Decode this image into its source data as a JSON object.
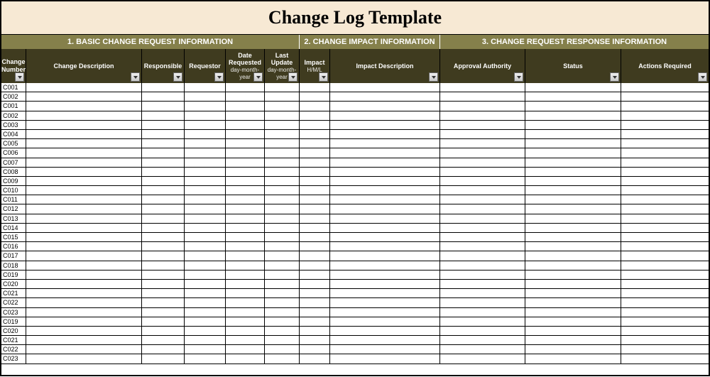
{
  "title": "Change Log Template",
  "sections": [
    "1. BASIC CHANGE REQUEST INFORMATION",
    "2. CHANGE IMPACT INFORMATION",
    "3. CHANGE REQUEST RESPONSE INFORMATION"
  ],
  "columns": [
    {
      "label": "Change Number",
      "sub": ""
    },
    {
      "label": "Change Description",
      "sub": ""
    },
    {
      "label": "Responsible",
      "sub": ""
    },
    {
      "label": "Requestor",
      "sub": ""
    },
    {
      "label": "Date Requested",
      "sub": "day-month-year"
    },
    {
      "label": "Last Update",
      "sub": "day-month-year"
    },
    {
      "label": "Impact",
      "sub": "H/M/L"
    },
    {
      "label": "Impact Description",
      "sub": ""
    },
    {
      "label": "Approval Authority",
      "sub": ""
    },
    {
      "label": "Status",
      "sub": ""
    },
    {
      "label": "Actions Required",
      "sub": ""
    }
  ],
  "rows": [
    {
      "change_number": "C001"
    },
    {
      "change_number": "C002"
    },
    {
      "change_number": "C001"
    },
    {
      "change_number": "C002"
    },
    {
      "change_number": "C003"
    },
    {
      "change_number": "C004"
    },
    {
      "change_number": "C005"
    },
    {
      "change_number": "C006"
    },
    {
      "change_number": "C007"
    },
    {
      "change_number": "C008"
    },
    {
      "change_number": "C009"
    },
    {
      "change_number": "C010"
    },
    {
      "change_number": "C011"
    },
    {
      "change_number": "C012"
    },
    {
      "change_number": "C013"
    },
    {
      "change_number": "C014"
    },
    {
      "change_number": "C015"
    },
    {
      "change_number": "C016"
    },
    {
      "change_number": "C017"
    },
    {
      "change_number": "C018"
    },
    {
      "change_number": "C019"
    },
    {
      "change_number": "C020"
    },
    {
      "change_number": "C021"
    },
    {
      "change_number": "C022"
    },
    {
      "change_number": "C023"
    },
    {
      "change_number": "C019"
    },
    {
      "change_number": "C020"
    },
    {
      "change_number": "C021"
    },
    {
      "change_number": "C022"
    },
    {
      "change_number": "C023"
    }
  ]
}
